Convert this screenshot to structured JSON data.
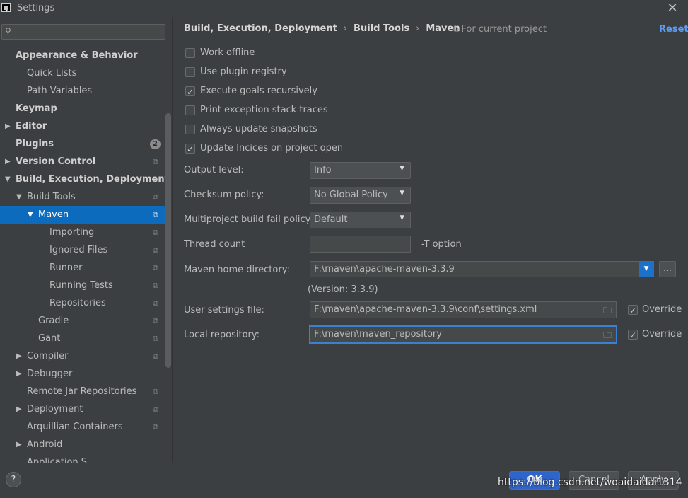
{
  "window": {
    "title": "Settings",
    "app_icon": "IJ"
  },
  "search": {
    "placeholder": ""
  },
  "tree": {
    "items": [
      {
        "label": "Appearance & Behavior",
        "bold": true,
        "arrow": "",
        "indent": 0,
        "copy": false
      },
      {
        "label": "Quick Lists",
        "bold": false,
        "arrow": "",
        "indent": 1,
        "copy": false
      },
      {
        "label": "Path Variables",
        "bold": false,
        "arrow": "",
        "indent": 1,
        "copy": false
      },
      {
        "label": "Keymap",
        "bold": true,
        "arrow": "",
        "indent": 0,
        "copy": false
      },
      {
        "label": "Editor",
        "bold": true,
        "arrow": "right",
        "indent": 0,
        "copy": false
      },
      {
        "label": "Plugins",
        "bold": true,
        "arrow": "",
        "indent": 0,
        "copy": false,
        "badge": "2"
      },
      {
        "label": "Version Control",
        "bold": true,
        "arrow": "right",
        "indent": 0,
        "copy": true
      },
      {
        "label": "Build, Execution, Deployment",
        "bold": true,
        "arrow": "down",
        "indent": 0,
        "copy": false
      },
      {
        "label": "Build Tools",
        "bold": false,
        "arrow": "down",
        "indent": 1,
        "copy": true
      },
      {
        "label": "Maven",
        "bold": false,
        "arrow": "down",
        "indent": 2,
        "copy": true,
        "selected": true
      },
      {
        "label": "Importing",
        "bold": false,
        "arrow": "",
        "indent": 3,
        "copy": true
      },
      {
        "label": "Ignored Files",
        "bold": false,
        "arrow": "",
        "indent": 3,
        "copy": true
      },
      {
        "label": "Runner",
        "bold": false,
        "arrow": "",
        "indent": 3,
        "copy": true
      },
      {
        "label": "Running Tests",
        "bold": false,
        "arrow": "",
        "indent": 3,
        "copy": true
      },
      {
        "label": "Repositories",
        "bold": false,
        "arrow": "",
        "indent": 3,
        "copy": true
      },
      {
        "label": "Gradle",
        "bold": false,
        "arrow": "",
        "indent": 2,
        "copy": true
      },
      {
        "label": "Gant",
        "bold": false,
        "arrow": "",
        "indent": 2,
        "copy": true
      },
      {
        "label": "Compiler",
        "bold": false,
        "arrow": "right",
        "indent": 1,
        "copy": true
      },
      {
        "label": "Debugger",
        "bold": false,
        "arrow": "right",
        "indent": 1,
        "copy": false
      },
      {
        "label": "Remote Jar Repositories",
        "bold": false,
        "arrow": "",
        "indent": 1,
        "copy": true
      },
      {
        "label": "Deployment",
        "bold": false,
        "arrow": "right",
        "indent": 1,
        "copy": true
      },
      {
        "label": "Arquillian Containers",
        "bold": false,
        "arrow": "",
        "indent": 1,
        "copy": true
      },
      {
        "label": "Android",
        "bold": false,
        "arrow": "right",
        "indent": 1,
        "copy": false
      },
      {
        "label": "Application S...",
        "bold": false,
        "arrow": "",
        "indent": 1,
        "copy": false
      }
    ]
  },
  "header": {
    "crumbs": [
      "Build, Execution, Deployment",
      "Build Tools",
      "Maven"
    ],
    "scope": "For current project",
    "reset": "Reset"
  },
  "options": [
    {
      "label": "Work offline",
      "checked": false
    },
    {
      "label": "Use plugin registry",
      "checked": false
    },
    {
      "label": "Execute goals recursively",
      "checked": true
    },
    {
      "label": "Print exception stack traces",
      "checked": false
    },
    {
      "label": "Always update snapshots",
      "checked": false
    },
    {
      "label": "Update Incices on project open",
      "checked": true
    }
  ],
  "fields": {
    "output_level": {
      "label": "Output level:",
      "value": "Info"
    },
    "checksum_policy": {
      "label": "Checksum policy:",
      "value": "No Global Policy"
    },
    "multiproject_policy": {
      "label": "Multiproject build fail policy:",
      "value": "Default"
    },
    "thread_count": {
      "label": "Thread count",
      "value": "",
      "suffix": "-T option"
    },
    "maven_home": {
      "label": "Maven home directory:",
      "value": "F:\\maven\\apache-maven-3.3.9",
      "version": "(Version: 3.3.9)",
      "browse": "..."
    },
    "user_settings": {
      "label": "User settings file:",
      "value": "F:\\maven\\apache-maven-3.3.9\\conf\\settings.xml",
      "override_label": "Override",
      "override": true
    },
    "local_repo": {
      "label": "Local repository:",
      "value": "F:\\maven\\maven_repository",
      "override_label": "Override",
      "override": true
    }
  },
  "buttons": {
    "help": "?",
    "ok": "OK",
    "cancel": "Cancel",
    "apply": "Apply"
  },
  "watermark": "https://blog.csdn.net/woaidaidai1314",
  "colors": {
    "accent": "#0d6bbd",
    "link": "#589df6",
    "bg": "#3c3f41"
  }
}
